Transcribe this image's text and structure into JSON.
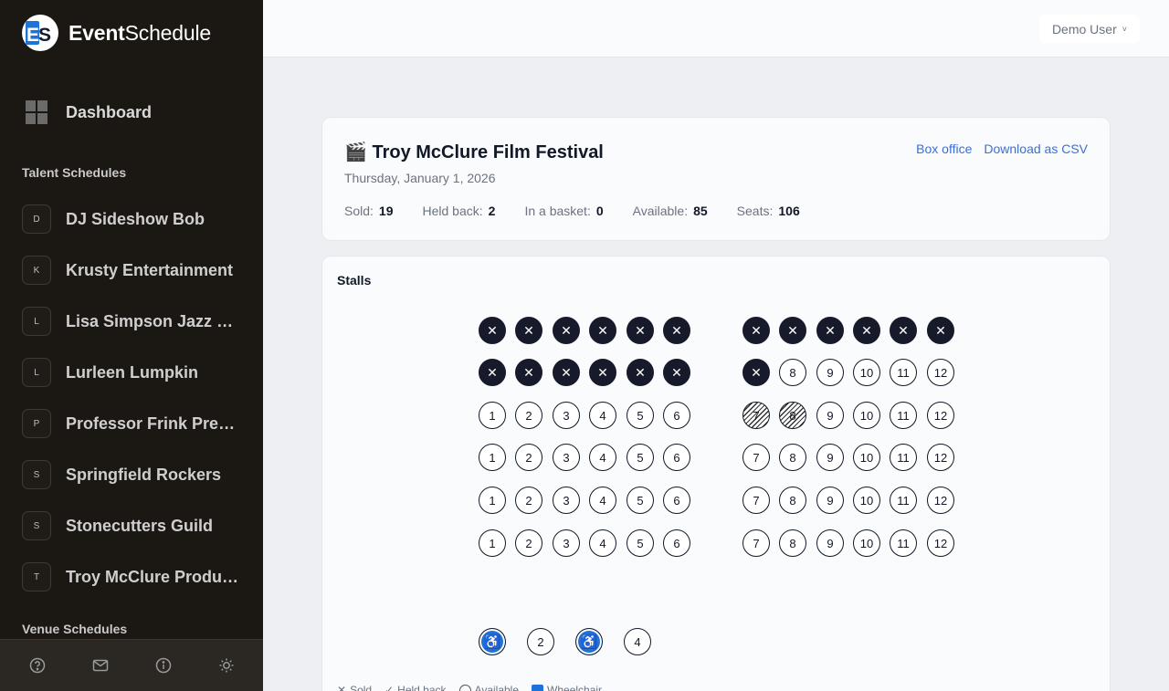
{
  "app": {
    "name_bold": "Event",
    "name_rest": "Schedule",
    "logo_letters": "ES"
  },
  "sidebar": {
    "dashboard_label": "Dashboard",
    "talent_heading": "Talent Schedules",
    "venue_heading": "Venue Schedules",
    "schedules": [
      {
        "badge": "D",
        "label": "DJ Sideshow Bob"
      },
      {
        "badge": "K",
        "label": "Krusty Entertainment"
      },
      {
        "badge": "L",
        "label": "Lisa Simpson Jazz Quartet"
      },
      {
        "badge": "L",
        "label": "Lurleen Lumpkin"
      },
      {
        "badge": "P",
        "label": "Professor Frink Presents"
      },
      {
        "badge": "S",
        "label": "Springfield Rockers"
      },
      {
        "badge": "S",
        "label": "Stonecutters Guild"
      },
      {
        "badge": "T",
        "label": "Troy McClure Productions"
      }
    ],
    "footer_icons": [
      "help-icon",
      "mail-icon",
      "info-icon",
      "theme-icon"
    ]
  },
  "header": {
    "user_label": "Demo User",
    "chevron": "˅"
  },
  "event": {
    "title": "🎬 Troy McClure Film Festival",
    "date": "Thursday, January 1, 2026",
    "links": {
      "box_office": "Box office",
      "download_csv": "Download as CSV"
    },
    "stats": [
      {
        "label": "Sold:",
        "value": "19"
      },
      {
        "label": "Held back:",
        "value": "2"
      },
      {
        "label": "In a basket:",
        "value": "0"
      },
      {
        "label": "Available:",
        "value": "85"
      },
      {
        "label": "Seats:",
        "value": "106"
      }
    ]
  },
  "seatmap": {
    "section_name": "Stalls",
    "rows": [
      [
        "S",
        "S",
        "S",
        "S",
        "S",
        "S",
        "S",
        "S",
        "S",
        "S",
        "S",
        "S"
      ],
      [
        "S",
        "S",
        "S",
        "S",
        "S",
        "S",
        "S",
        "8",
        "9",
        "10",
        "11",
        "12"
      ],
      [
        "1",
        "2",
        "3",
        "4",
        "5",
        "6",
        "H7",
        "H8",
        "9",
        "10",
        "11",
        "12"
      ],
      [
        "1",
        "2",
        "3",
        "4",
        "5",
        "6",
        "7",
        "8",
        "9",
        "10",
        "11",
        "12"
      ],
      [
        "1",
        "2",
        "3",
        "4",
        "5",
        "6",
        "7",
        "8",
        "9",
        "10",
        "11",
        "12"
      ],
      [
        "1",
        "2",
        "3",
        "4",
        "5",
        "6",
        "7",
        "8",
        "9",
        "10",
        "11",
        "12"
      ]
    ],
    "accessible_row": [
      "W",
      "2",
      "W",
      "4"
    ],
    "legend": [
      "Sold",
      "Held back",
      "Available",
      "Wheelchair"
    ],
    "colors": {
      "sold": "#161a2b",
      "wheelchair": "#1d73d9",
      "link": "#3b6fd8"
    }
  }
}
